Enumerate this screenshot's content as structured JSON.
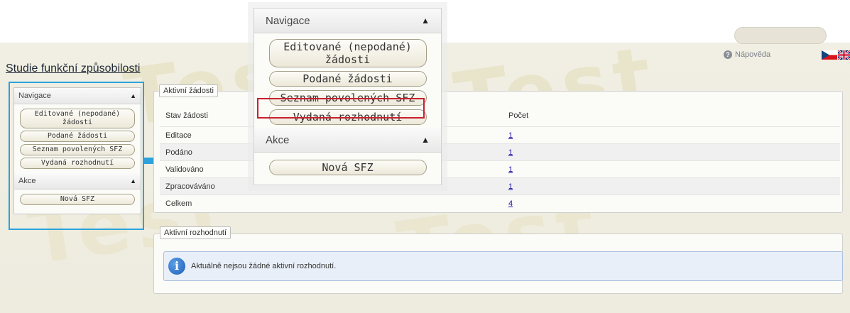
{
  "header": {
    "title": "Studie funkční způsobilosti",
    "top_pill_text": "",
    "help_label": "Nápověda",
    "help_icon": "question-icon",
    "flags": [
      "cz-flag",
      "uk-flag"
    ]
  },
  "watermark_text": "Test",
  "sidebar": {
    "nav_title": "Navigace",
    "nav_items": [
      {
        "label": "Editované (nepodané) žádosti"
      },
      {
        "label": "Podané žádosti"
      },
      {
        "label": "Seznam povolených SFZ"
      },
      {
        "label": "Vydaná rozhodnutí"
      }
    ],
    "actions_title": "Akce",
    "action_items": [
      {
        "label": "Nová SFZ"
      }
    ]
  },
  "zoom": {
    "nav_title": "Navigace",
    "nav_items": [
      {
        "label": "Editované (nepodané) žádosti"
      },
      {
        "label": "Podané žádosti"
      },
      {
        "label": "Seznam povolených SFZ"
      },
      {
        "label": "Vydaná rozhodnutí"
      }
    ],
    "actions_title": "Akce",
    "action_items": [
      {
        "label": "Nová SFZ"
      }
    ],
    "highlighted_item": "Podané žádosti"
  },
  "active_requests": {
    "legend": "Aktivní žádosti",
    "columns": [
      "Stav žádosti",
      "Počet"
    ],
    "rows": [
      {
        "status": "Editace",
        "count": "1"
      },
      {
        "status": "Podáno",
        "count": "1"
      },
      {
        "status": "Validováno",
        "count": "1"
      },
      {
        "status": "Zpracováváno",
        "count": "1"
      },
      {
        "status": "Celkem",
        "count": "4"
      }
    ]
  },
  "active_decisions": {
    "legend": "Aktivní rozhodnutí",
    "message": "Aktuálně nejsou žádné aktivní rozhodnutí."
  },
  "colors": {
    "highlight_frame": "#29a3dd",
    "arrow": "#2da1db",
    "zoom_highlight": "#c9202e",
    "info_background": "#e9eff8"
  }
}
